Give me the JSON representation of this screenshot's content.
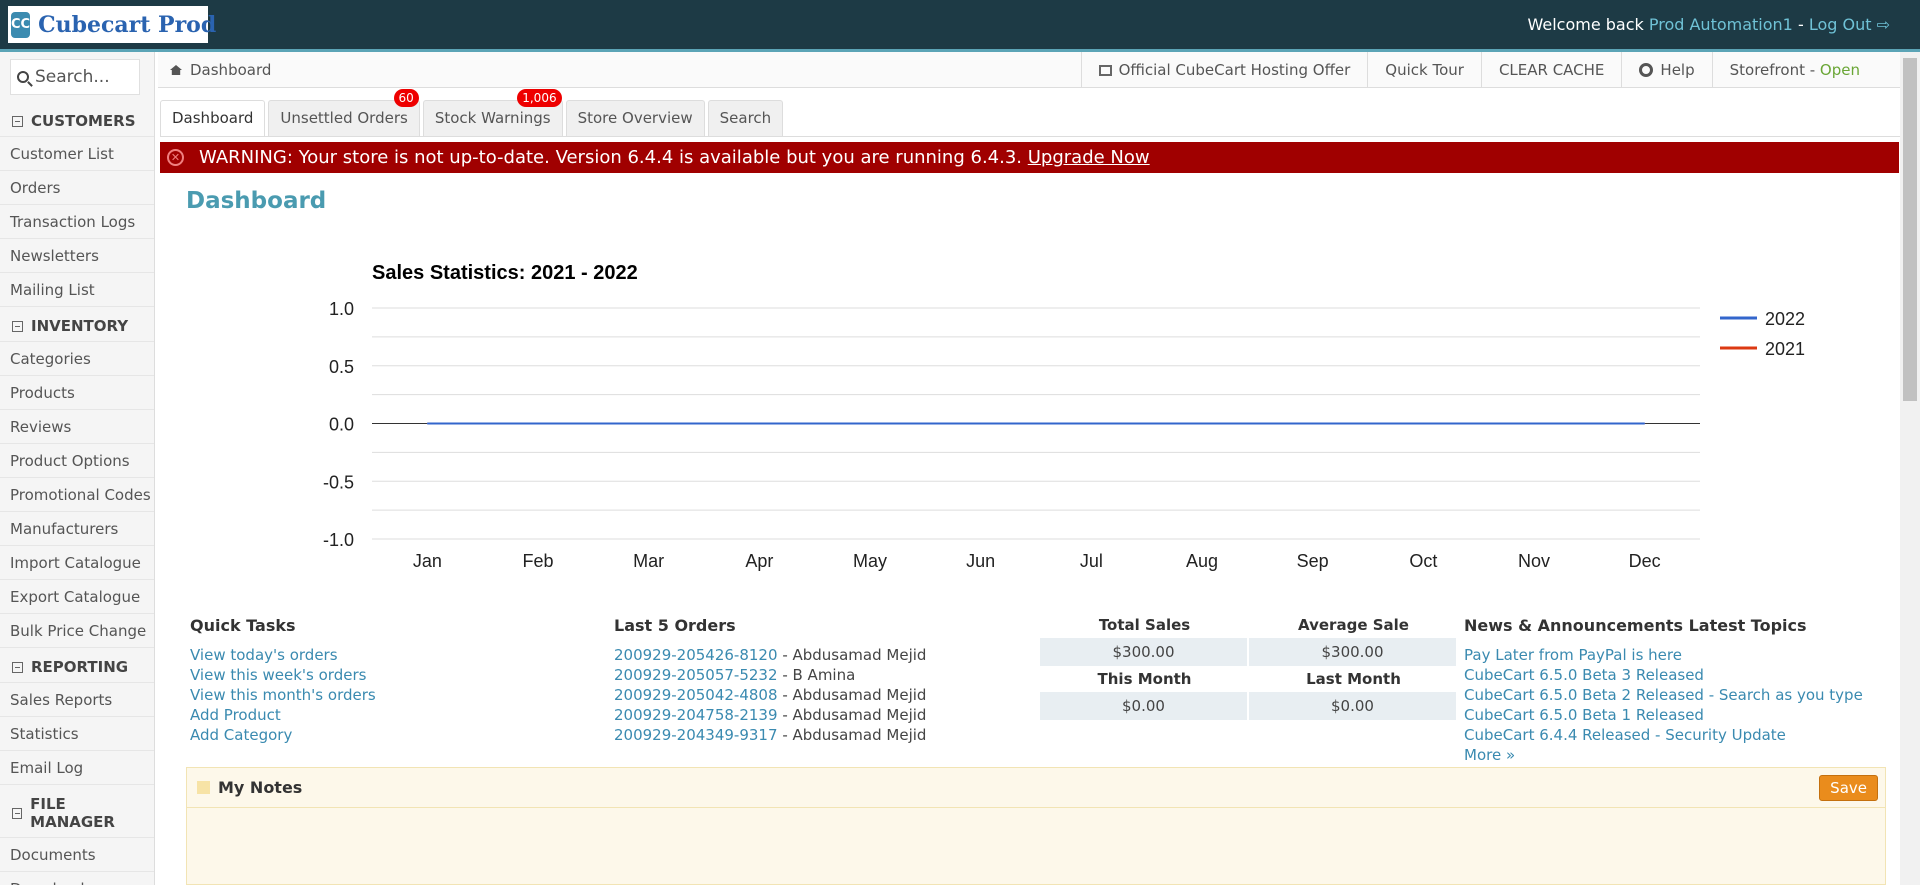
{
  "app": {
    "logo_mark": "CC",
    "logo_text": "Cubecart Prod",
    "welcome_prefix": "Welcome back",
    "user_name": "Prod Automation1",
    "separator": "-",
    "logout_label": "Log Out"
  },
  "sidebar": {
    "search_placeholder": "Search...",
    "sections": [
      {
        "title": "CUSTOMERS",
        "items": [
          "Customer List",
          "Orders",
          "Transaction Logs",
          "Newsletters",
          "Mailing List"
        ]
      },
      {
        "title": "INVENTORY",
        "items": [
          "Categories",
          "Products",
          "Reviews",
          "Product Options",
          "Promotional Codes",
          "Manufacturers",
          "Import Catalogue",
          "Export Catalogue",
          "Bulk Price Change"
        ]
      },
      {
        "title": "REPORTING",
        "items": [
          "Sales Reports",
          "Statistics",
          "Email Log"
        ]
      },
      {
        "title": "FILE MANAGER",
        "items": [
          "Documents",
          "Downloads"
        ]
      }
    ]
  },
  "breadcrumb": {
    "label": "Dashboard"
  },
  "topnav": {
    "hosting": "Official CubeCart Hosting Offer",
    "tour": "Quick Tour",
    "cache": "CLEAR CACHE",
    "help": "Help",
    "storefront": "Storefront",
    "storefront_status": "Open"
  },
  "tabs": [
    {
      "label": "Dashboard",
      "badge": ""
    },
    {
      "label": "Unsettled Orders",
      "badge": "60"
    },
    {
      "label": "Stock Warnings",
      "badge": "1,006"
    },
    {
      "label": "Store Overview",
      "badge": ""
    },
    {
      "label": "Search",
      "badge": ""
    }
  ],
  "warning": {
    "text": "WARNING: Your store is not up-to-date. Version 6.4.4 is available but you are running 6.4.3.",
    "link": "Upgrade Now"
  },
  "page_title": "Dashboard",
  "chart_data": {
    "type": "line",
    "title": "Sales Statistics: 2021 - 2022",
    "categories": [
      "Jan",
      "Feb",
      "Mar",
      "Apr",
      "May",
      "Jun",
      "Jul",
      "Aug",
      "Sep",
      "Oct",
      "Nov",
      "Dec"
    ],
    "series": [
      {
        "name": "2022",
        "color": "#3366cc",
        "values": [
          0,
          0,
          0,
          0,
          0,
          0,
          0,
          0,
          0,
          0,
          0,
          0
        ]
      },
      {
        "name": "2021",
        "color": "#dc3912",
        "values": [
          0,
          0,
          0,
          0,
          0,
          0,
          0,
          0,
          0,
          0,
          0,
          0
        ]
      }
    ],
    "yticks": [
      "1.0",
      "0.5",
      "0.0",
      "-0.5",
      "-1.0"
    ],
    "ylim": [
      -1,
      1
    ],
    "grid": true,
    "legend": "right"
  },
  "quick_tasks": {
    "title": "Quick Tasks",
    "items": [
      "View today's orders",
      "View this week's orders",
      "View this month's orders",
      "Add Product",
      "Add Category"
    ]
  },
  "last_orders": {
    "title": "Last 5 Orders",
    "items": [
      {
        "id": "200929-205426-8120",
        "name": "- Abdusamad Mejid"
      },
      {
        "id": "200929-205057-5232",
        "name": "- B Amina"
      },
      {
        "id": "200929-205042-4808",
        "name": "- Abdusamad Mejid"
      },
      {
        "id": "200929-204758-2139",
        "name": "- Abdusamad Mejid"
      },
      {
        "id": "200929-204349-9317",
        "name": "- Abdusamad Mejid"
      }
    ]
  },
  "stats": {
    "total_sales_label": "Total Sales",
    "total_sales": "$300.00",
    "average_sale_label": "Average Sale",
    "average_sale": "$300.00",
    "this_month_label": "This Month",
    "this_month": "$0.00",
    "last_month_label": "Last Month",
    "last_month": "$0.00"
  },
  "news": {
    "title": "News & Announcements Latest Topics",
    "items": [
      "Pay Later from PayPal is here",
      "CubeCart 6.5.0 Beta 3 Released",
      "CubeCart 6.5.0 Beta 2 Released - Search as you type",
      "CubeCart 6.5.0 Beta 1 Released",
      "CubeCart 6.4.4 Released - Security Update"
    ],
    "more": "More »"
  },
  "notes": {
    "title": "My Notes",
    "save_label": "Save"
  }
}
